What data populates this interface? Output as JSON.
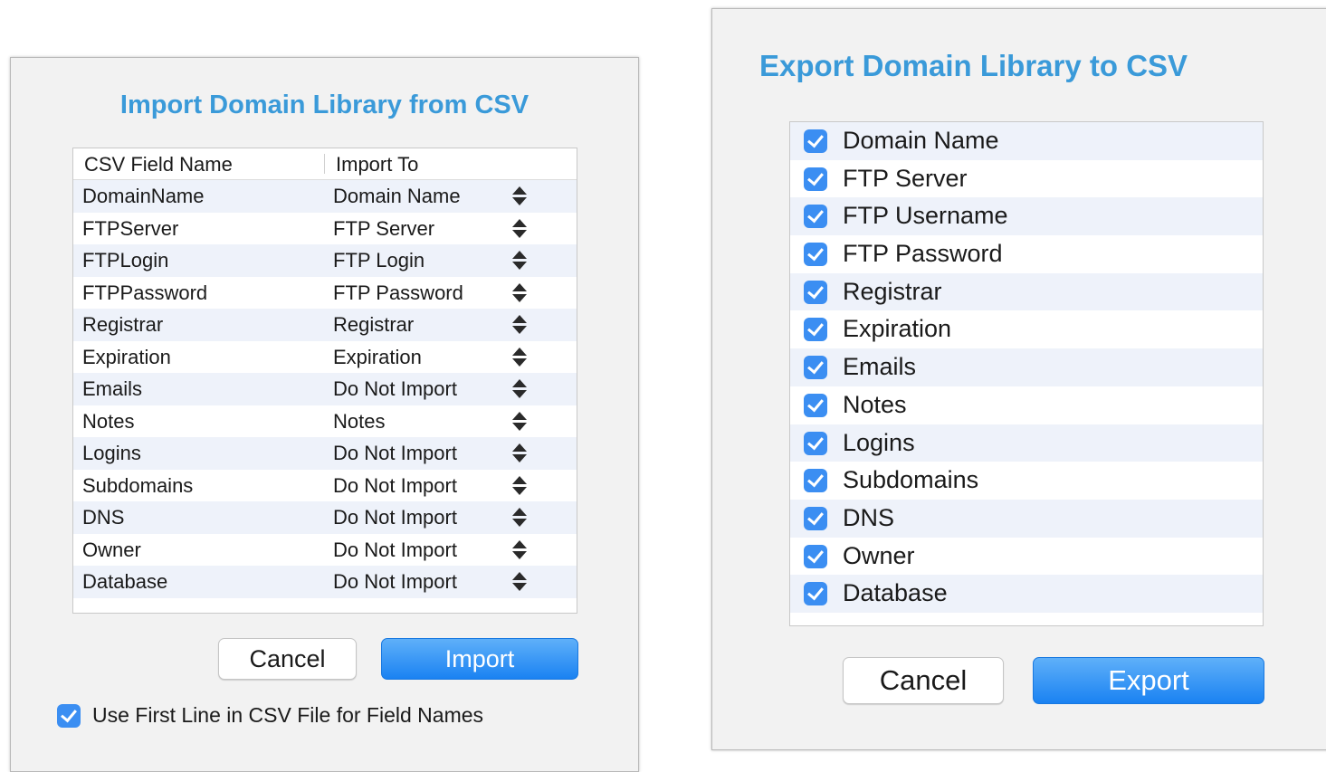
{
  "import_dialog": {
    "title": "Import Domain Library from CSV",
    "columns": [
      "CSV Field Name",
      "Import To"
    ],
    "rows": [
      {
        "field": "DomainName",
        "import_to": "Domain Name"
      },
      {
        "field": "FTPServer",
        "import_to": "FTP Server"
      },
      {
        "field": "FTPLogin",
        "import_to": "FTP Login"
      },
      {
        "field": "FTPPassword",
        "import_to": "FTP Password"
      },
      {
        "field": "Registrar",
        "import_to": "Registrar"
      },
      {
        "field": "Expiration",
        "import_to": "Expiration"
      },
      {
        "field": "Emails",
        "import_to": "Do Not Import"
      },
      {
        "field": "Notes",
        "import_to": "Notes"
      },
      {
        "field": "Logins",
        "import_to": "Do Not Import"
      },
      {
        "field": "Subdomains",
        "import_to": "Do Not Import"
      },
      {
        "field": "DNS",
        "import_to": "Do Not Import"
      },
      {
        "field": "Owner",
        "import_to": "Do Not Import"
      },
      {
        "field": "Database",
        "import_to": "Do Not Import"
      }
    ],
    "cancel_label": "Cancel",
    "import_label": "Import",
    "first_line_label": "Use First Line in CSV File for Field Names",
    "first_line_checked": true
  },
  "export_dialog": {
    "title": "Export Domain Library to CSV",
    "fields": [
      {
        "label": "Domain Name",
        "checked": true
      },
      {
        "label": "FTP Server",
        "checked": true
      },
      {
        "label": "FTP Username",
        "checked": true
      },
      {
        "label": "FTP Password",
        "checked": true
      },
      {
        "label": "Registrar",
        "checked": true
      },
      {
        "label": "Expiration",
        "checked": true
      },
      {
        "label": "Emails",
        "checked": true
      },
      {
        "label": "Notes",
        "checked": true
      },
      {
        "label": "Logins",
        "checked": true
      },
      {
        "label": "Subdomains",
        "checked": true
      },
      {
        "label": "DNS",
        "checked": true
      },
      {
        "label": "Owner",
        "checked": true
      },
      {
        "label": "Database",
        "checked": true
      }
    ],
    "cancel_label": "Cancel",
    "export_label": "Export"
  },
  "colors": {
    "title": "#3a9ad9",
    "primary_button": "#1a82f2",
    "checkbox": "#3b8ef2",
    "row_alt": "#eef2fa"
  },
  "icons": {
    "stepper": "up-down-stepper-icon",
    "checkbox": "checkmark-icon"
  }
}
